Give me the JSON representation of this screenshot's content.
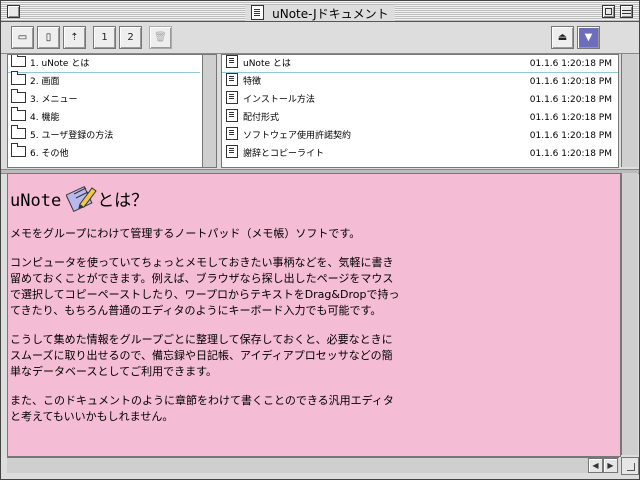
{
  "window": {
    "title": "uNote-Jドキュメント"
  },
  "toolbar": {
    "buttons": [
      {
        "name": "new-folder-button",
        "glyph": "▭"
      },
      {
        "name": "new-note-button",
        "glyph": "▯"
      },
      {
        "name": "up-level-button",
        "glyph": "⇡"
      },
      {
        "name": "view1-button",
        "glyph": "1"
      },
      {
        "name": "view2-button",
        "glyph": "2"
      },
      {
        "name": "trash-button",
        "glyph": "🗑"
      }
    ],
    "eject_glyph": "⏏",
    "down_glyph": "▼"
  },
  "sections": [
    {
      "label": "1. uNote とは"
    },
    {
      "label": "2. 画面"
    },
    {
      "label": "3. メニュー"
    },
    {
      "label": "4. 機能"
    },
    {
      "label": "5. ユーザ登録の方法"
    },
    {
      "label": "6. その他"
    }
  ],
  "pages": [
    {
      "title": "uNote とは",
      "date": "01.1.6 1:20:18 PM"
    },
    {
      "title": "特徴",
      "date": "01.1.6 1:20:18 PM"
    },
    {
      "title": "インストール方法",
      "date": "01.1.6 1:20:18 PM"
    },
    {
      "title": "配付形式",
      "date": "01.1.6 1:20:18 PM"
    },
    {
      "title": "ソフトウェア使用許諾契約",
      "date": "01.1.6 1:20:18 PM"
    },
    {
      "title": "謝辞とコピーライト",
      "date": "01.1.6 1:20:18 PM"
    }
  ],
  "content": {
    "heading_prefix": "uNote",
    "heading_suffix": "とは？",
    "paragraphs": [
      "メモをグループにわけて管理するノートパッド（メモ帳）ソフトです。",
      "コンピュータを使っていてちょっとメモしておきたい事柄などを、気軽に書き\n留めておくことができます。例えば、ブラウザなら探し出したページをマウス\nで選択してコピーペーストしたり、ワープロからテキストをDrag&Dropで持っ\nてきたり、もちろん普通のエディタのようにキーボード入力でも可能です。",
      "こうして集めた情報をグループごとに整理して保存しておくと、必要なときに\nスムーズに取り出せるので、備忘録や日記帳、アイディアプロセッサなどの簡\n単なデータベースとしてご利用できます。",
      "また、このドキュメントのように章節をわけて書くことのできる汎用エディタ\nと考えてもいいかもしれません。"
    ]
  }
}
